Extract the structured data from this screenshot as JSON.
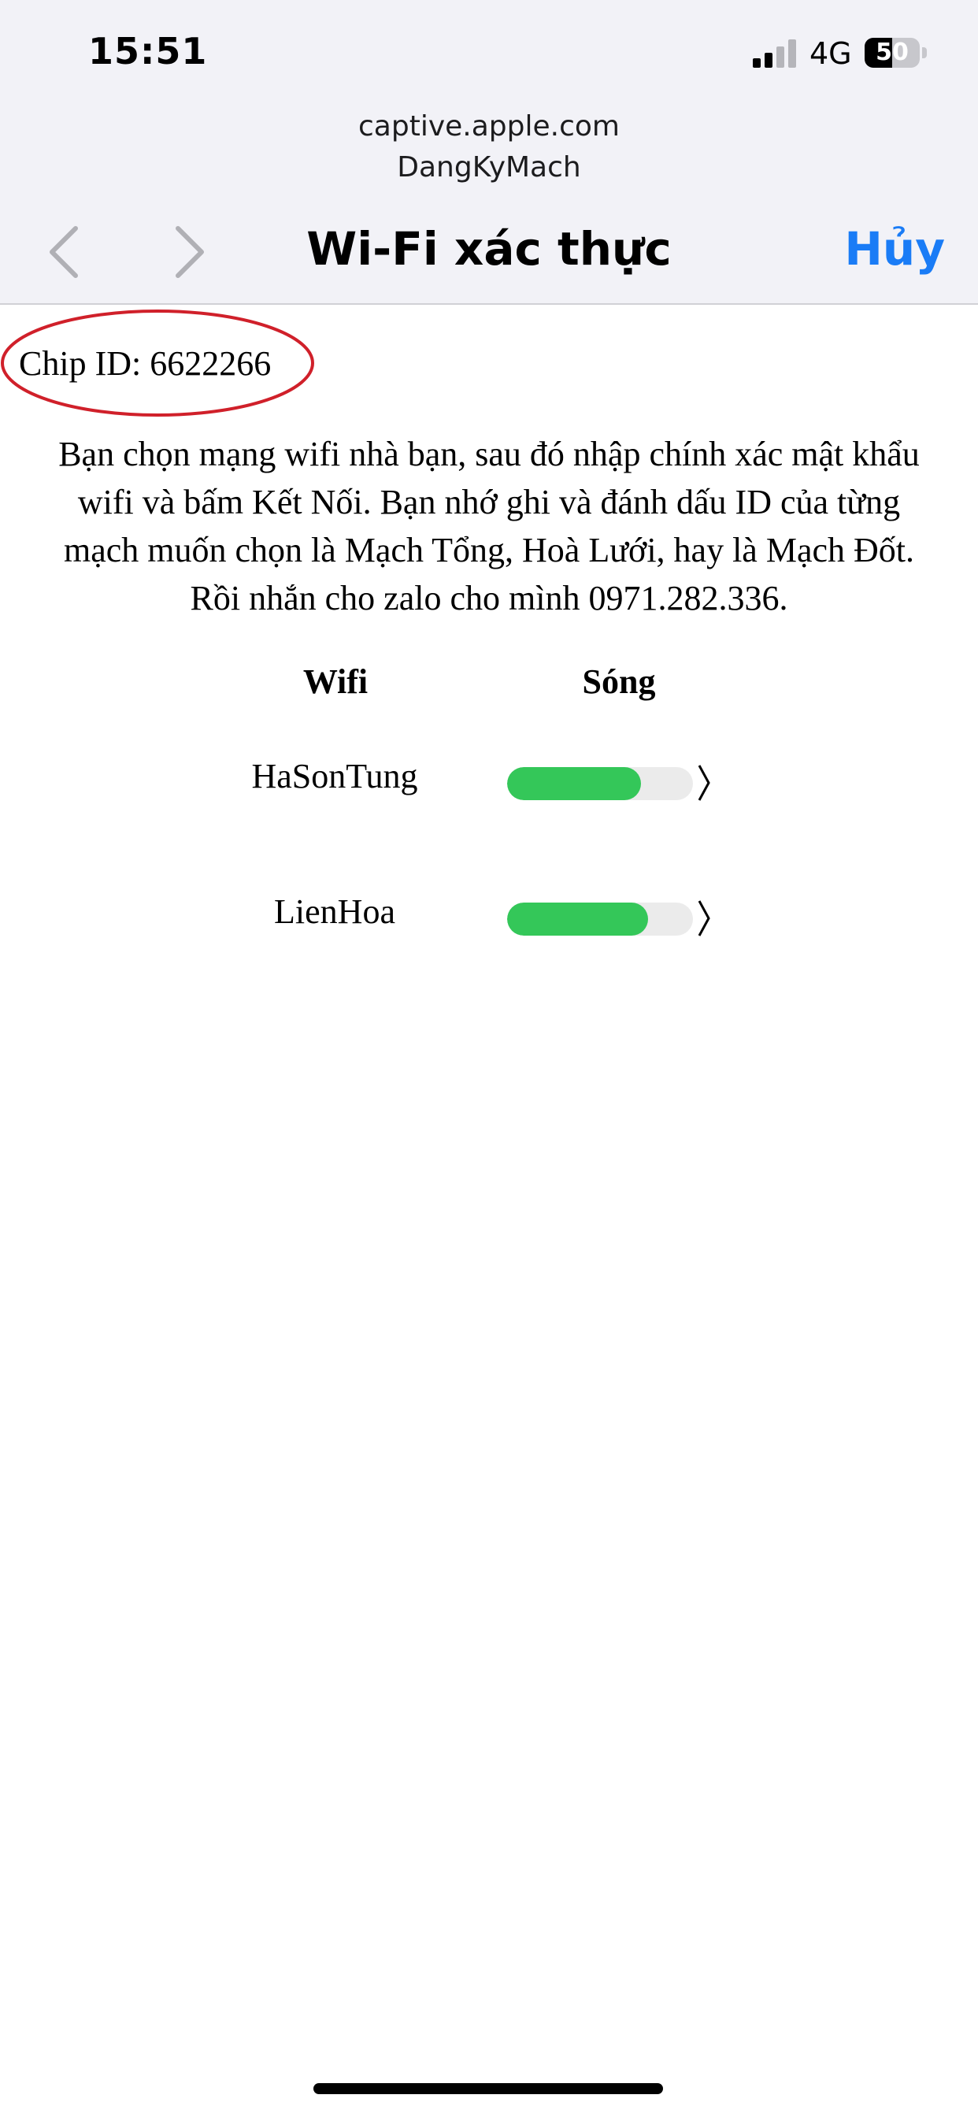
{
  "status_bar": {
    "time": "15:51",
    "network": "4G",
    "signal_bars_active": 2,
    "signal_bars_total": 4,
    "battery_percent": "50",
    "battery_level": 0.5
  },
  "browser": {
    "domain": "captive.apple.com",
    "page": "DangKyMach",
    "title": "Wi-Fi xác thực",
    "cancel_label": "Hủy",
    "back_icon": "chevron-left-icon",
    "forward_icon": "chevron-right-icon"
  },
  "content": {
    "chip_id": "Chip ID: 6622266",
    "instructions": [
      "Bạn chọn mạng wifi nhà bạn, sau đó nhập chính xác mật khẩu",
      "wifi và bấm Kết Nối. Bạn nhớ ghi và đánh dấu ID của từng",
      "mạch muốn chọn là Mạch Tổng, Hoà Lưới, hay là Mạch Đốt.",
      "Rồi nhắn cho zalo cho mình 0971.282.336."
    ],
    "table": {
      "col_wifi": "Wifi",
      "col_signal": "Sóng",
      "networks": [
        {
          "name": "HaSonTung",
          "signal": 0.72
        },
        {
          "name": "LienHoa",
          "signal": 0.76
        }
      ]
    }
  },
  "colors": {
    "accent": "#1a7cf6",
    "signal_fill": "#34c759",
    "signal_track": "#ebebeb",
    "highlight_ellipse": "#d0202a",
    "header_bg": "#f2f2f7"
  }
}
